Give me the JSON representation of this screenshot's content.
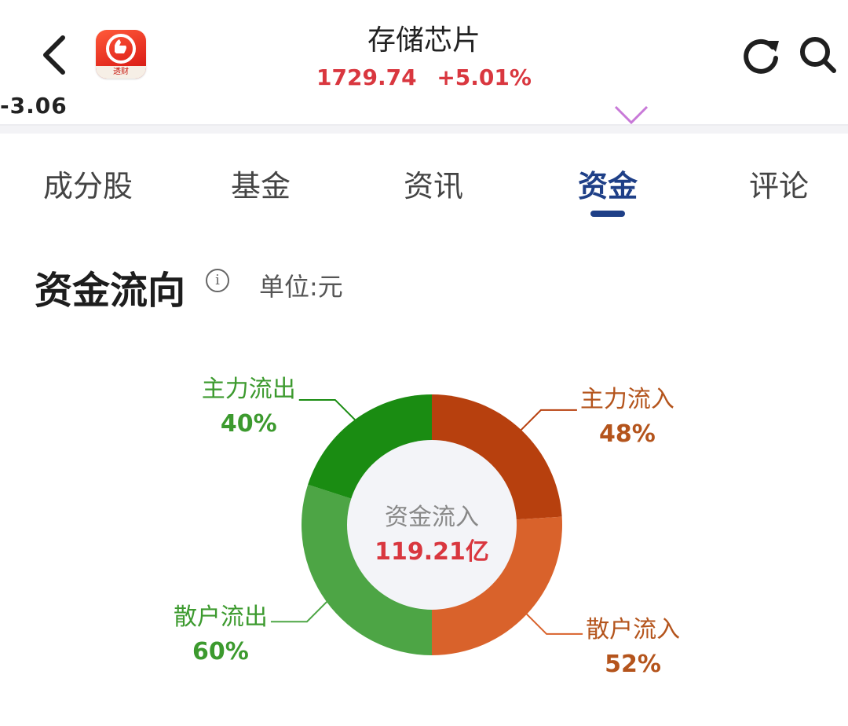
{
  "header": {
    "title": "存储芯片",
    "price": "1729.74",
    "change": "+5.01%",
    "partial_value": "-3.06",
    "app_logo_text": "透财"
  },
  "tabs": [
    {
      "label": "成分股",
      "active": false
    },
    {
      "label": "基金",
      "active": false
    },
    {
      "label": "资讯",
      "active": false
    },
    {
      "label": "资金",
      "active": true
    },
    {
      "label": "评论",
      "active": false
    }
  ],
  "section": {
    "title": "资金流向",
    "info_icon": "info-circle-icon",
    "unit": "单位:元"
  },
  "chart_data": {
    "type": "pie",
    "center_label": "资金流入",
    "center_value": "119.21亿",
    "slices": [
      {
        "label": "主力流入",
        "value": 48,
        "pct_text": "48%",
        "color": "#b7400e"
      },
      {
        "label": "散户流入",
        "value": 52,
        "pct_text": "52%",
        "color": "#d9622b"
      },
      {
        "label": "散户流出",
        "value": 60,
        "pct_text": "60%",
        "color": "#4da545"
      },
      {
        "label": "主力流出",
        "value": 40,
        "pct_text": "40%",
        "color": "#1a8c12"
      }
    ],
    "colors": {
      "inflow_text": "#b4541c",
      "outflow_text": "#3c9a2e",
      "center_value": "#d9373f",
      "center_label": "#888888",
      "inner_fill": "#f3f4f8"
    }
  }
}
